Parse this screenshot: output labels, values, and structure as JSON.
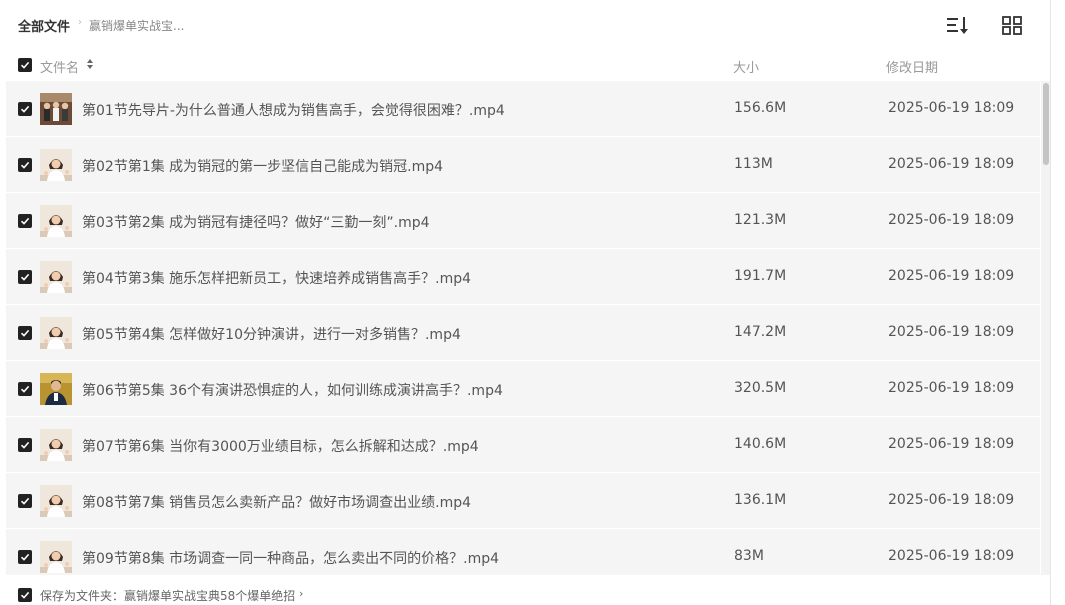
{
  "breadcrumb": {
    "root": "全部文件",
    "separator": "›",
    "current": "赢销爆单实战宝..."
  },
  "toolbar": {
    "sort_icon": "sort-list-icon",
    "grid_icon": "grid-view-icon"
  },
  "columns": {
    "name": "文件名",
    "size": "大小",
    "modified": "修改日期"
  },
  "files": [
    {
      "name": "第01节先导片-为什么普通人想成为销售高手，会觉得很困难？.mp4",
      "size": "156.6M",
      "modified": "2025-06-19 18:09",
      "thumb": "group-photo"
    },
    {
      "name": "第02节第1集 成为销冠的第一步坚信自己能成为销冠.mp4",
      "size": "113M",
      "modified": "2025-06-19 18:09",
      "thumb": "presenter"
    },
    {
      "name": "第03节第2集 成为销冠有捷径吗？做好“三勤一刻”.mp4",
      "size": "121.3M",
      "modified": "2025-06-19 18:09",
      "thumb": "presenter"
    },
    {
      "name": "第04节第3集 施乐怎样把新员工，快速培养成销售高手？.mp4",
      "size": "191.7M",
      "modified": "2025-06-19 18:09",
      "thumb": "presenter"
    },
    {
      "name": "第05节第4集 怎样做好10分钟演讲，进行一对多销售？.mp4",
      "size": "147.2M",
      "modified": "2025-06-19 18:09",
      "thumb": "presenter"
    },
    {
      "name": "第06节第5集 36个有演讲恐惧症的人，如何训练成演讲高手？.mp4",
      "size": "320.5M",
      "modified": "2025-06-19 18:09",
      "thumb": "speaker"
    },
    {
      "name": "第07节第6集 当你有3000万业绩目标，怎么拆解和达成？.mp4",
      "size": "140.6M",
      "modified": "2025-06-19 18:09",
      "thumb": "presenter"
    },
    {
      "name": "第08节第7集 销售员怎么卖新产品？做好市场调查出业绩.mp4",
      "size": "136.1M",
      "modified": "2025-06-19 18:09",
      "thumb": "presenter"
    },
    {
      "name": "第09节第8集 市场调查一同一种商品，怎么卖出不同的价格？.mp4",
      "size": "83M",
      "modified": "2025-06-19 18:09",
      "thumb": "presenter"
    }
  ],
  "footer": {
    "save_to": "保存为文件夹：赢销爆单实战宝典58个爆单绝招",
    "arrow": "›"
  },
  "colors": {
    "row_bg": "#f5f5f6",
    "checkbox": "#222222",
    "text": "#555555",
    "muted": "#999999"
  }
}
